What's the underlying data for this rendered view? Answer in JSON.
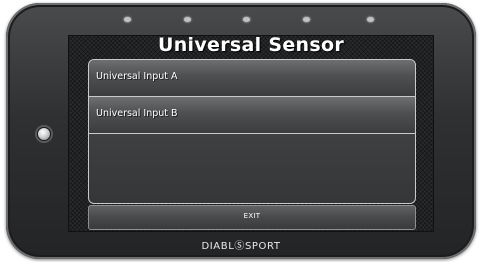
{
  "window": {
    "title": "Universal Sensor"
  },
  "list": {
    "items": [
      {
        "label": "Universal Input A"
      },
      {
        "label": "Universal Input B"
      }
    ]
  },
  "footer": {
    "exit_label": "EXIT"
  },
  "device": {
    "brand": "DIABLⓈSPORT",
    "side_button_icon": "home-button-icon",
    "indicator_led_count": 5
  },
  "colors": {
    "bezel": "#2f3032",
    "screen_background": "#2a2b2d",
    "list_border": "#c9cacc",
    "text": "#ffffff"
  }
}
